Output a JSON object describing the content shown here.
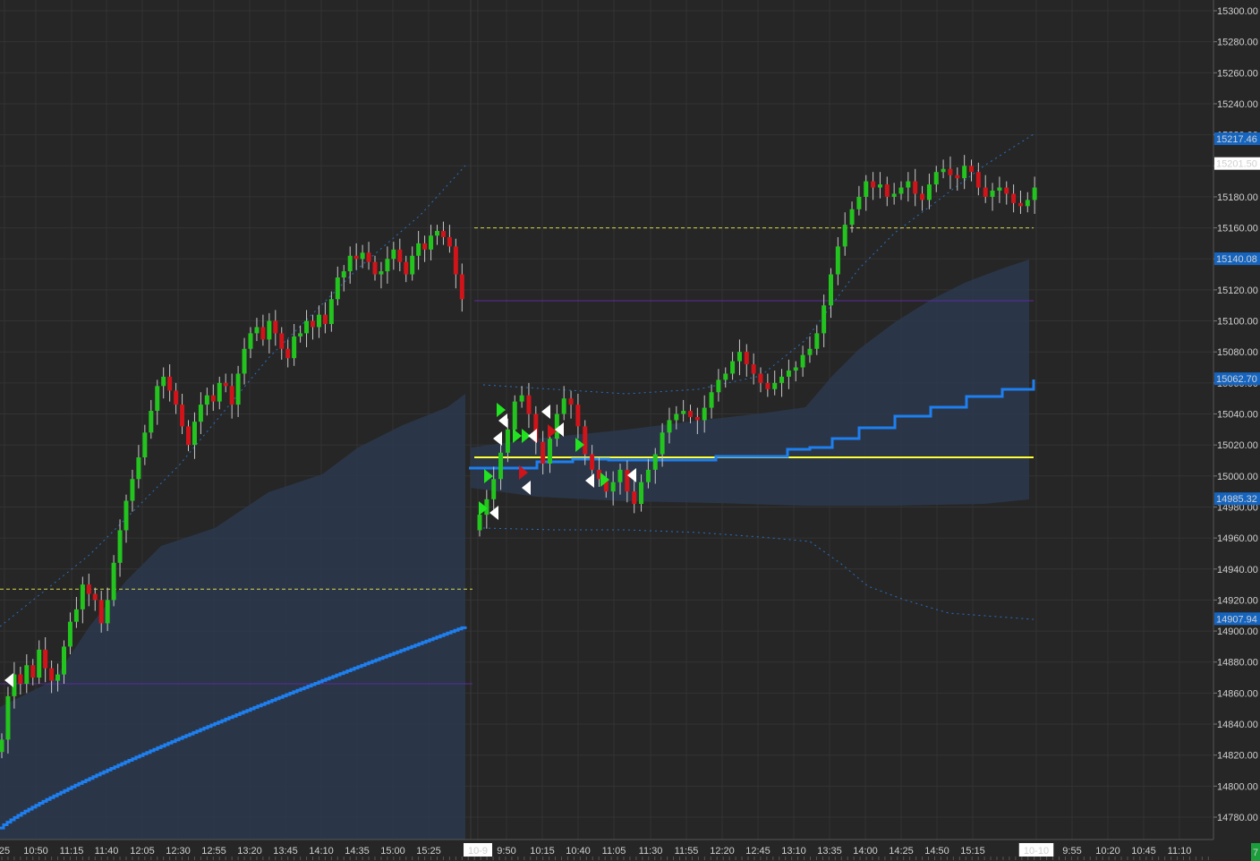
{
  "chart_data": {
    "type": "candlestick",
    "y_axis": {
      "ylim": [
        14770,
        15305
      ],
      "tick_labels": [
        "15300.00",
        "15280.00",
        "15260.00",
        "15240.00",
        "15220.00",
        "15200.00",
        "15180.00",
        "15160.00",
        "15140.00",
        "15120.00",
        "15100.00",
        "15080.00",
        "15060.00",
        "15040.00",
        "15020.00",
        "15000.00",
        "14980.00",
        "14960.00",
        "14940.00",
        "14920.00",
        "14900.00",
        "14880.00",
        "14860.00",
        "14840.00",
        "14820.00",
        "14800.00",
        "14780.00"
      ]
    },
    "x_axis": {
      "tick_labels": [
        "25",
        "10:50",
        "11:15",
        "11:40",
        "12:05",
        "12:30",
        "12:55",
        "13:20",
        "13:45",
        "14:10",
        "14:35",
        "15:00",
        "15:25",
        "10-9",
        "9:50",
        "10:15",
        "10:40",
        "11:05",
        "11:30",
        "11:55",
        "12:20",
        "12:45",
        "13:10",
        "13:35",
        "14:00",
        "14:25",
        "14:50",
        "15:15",
        "10-10",
        "9:55",
        "10:20",
        "10:45",
        "11:10"
      ],
      "session_labels": [
        "10-9",
        "10-10"
      ]
    },
    "price_badges": [
      {
        "label": "15217.46",
        "value": 15217.46,
        "style": "blue"
      },
      {
        "label": "15201.50",
        "value": 15201.5,
        "style": "white"
      },
      {
        "label": "15140.08",
        "value": 15140.08,
        "style": "blue"
      },
      {
        "label": "15062.70",
        "value": 15062.7,
        "style": "blue"
      },
      {
        "label": "14985.32",
        "value": 14985.32,
        "style": "blue"
      },
      {
        "label": "14907.94",
        "value": 14907.94,
        "style": "blue"
      }
    ],
    "corner_badge": "7",
    "day1_closes": [
      14830,
      14858,
      14872,
      14866,
      14878,
      14870,
      14888,
      14876,
      14868,
      14872,
      14890,
      14906,
      14914,
      14930,
      14924,
      14920,
      14905,
      14920,
      14944,
      14965,
      14984,
      14998,
      15012,
      15028,
      15042,
      15058,
      15064,
      15055,
      15046,
      15032,
      15020,
      15035,
      15046,
      15052,
      15048,
      15060,
      15058,
      15046,
      15066,
      15082,
      15092,
      15096,
      15088,
      15100,
      15092,
      15082,
      15076,
      15090,
      15092,
      15100,
      15096,
      15104,
      15098,
      15114,
      15128,
      15132,
      15142,
      15140,
      15144,
      15138,
      15130,
      15132,
      15140,
      15146,
      15138,
      15130,
      15142,
      15150,
      15146,
      15155,
      15158,
      15154,
      15148,
      15130,
      15114
    ],
    "day2_closes": [
      14975,
      14985,
      14998,
      15015,
      15030,
      15048,
      15052,
      15040,
      15022,
      15008,
      15024,
      15040,
      15050,
      15046,
      15032,
      15014,
      15004,
      14998,
      14990,
      14996,
      15004,
      14990,
      14982,
      14996,
      15004,
      15014,
      15028,
      15036,
      15040,
      15042,
      15038,
      15036,
      15044,
      15054,
      15062,
      15066,
      15074,
      15080,
      15072,
      15066,
      15060,
      15056,
      15060,
      15064,
      15068,
      15070,
      15078,
      15082,
      15092,
      15110,
      15130,
      15148,
      15162,
      15172,
      15180,
      15190,
      15186,
      15188,
      15180,
      15182,
      15186,
      15190,
      15182,
      15178,
      15188,
      15196,
      15198,
      15194,
      15192,
      15200,
      15196,
      15186,
      15180,
      15184,
      15186,
      15182,
      15176,
      15174,
      15178,
      15186
    ],
    "series": [
      {
        "name": "VWAP",
        "color": "#1e7ff0",
        "ranges": [
          [
            14773,
            14903
          ],
          [
            15005,
            15060
          ]
        ]
      },
      {
        "name": "Upper band (dotted)",
        "color": "#2a6fc0"
      },
      {
        "name": "Lower band (dotted)",
        "color": "#2a6fc0"
      },
      {
        "name": "Value area (shaded)",
        "color": "#2b3a4e"
      }
    ],
    "levels": [
      {
        "value": 15012,
        "color": "#ffff33",
        "style": "solid",
        "session": 2
      },
      {
        "value": 15160,
        "color": "#d8d84a",
        "style": "dashed",
        "session": 2
      },
      {
        "value": 14927,
        "color": "#d8d84a",
        "style": "dashed",
        "session": 1
      },
      {
        "value": 15113,
        "color": "#5b2ba0",
        "style": "solid",
        "session": 2
      },
      {
        "value": 14866,
        "color": "#5b2ba0",
        "style": "solid",
        "session": 1
      }
    ],
    "colors": {
      "background": "#262626",
      "grid": "#333333",
      "up_candle": "#23c41e",
      "down_candle": "#d0141a",
      "wick": "#c8c8c8",
      "axis_text": "#d0d0d0",
      "badge_blue": "#1565c0",
      "corner_badge": "#1b9e3b"
    },
    "grid": true,
    "signals": "white and green triangle markers around the 10-9 session open"
  }
}
